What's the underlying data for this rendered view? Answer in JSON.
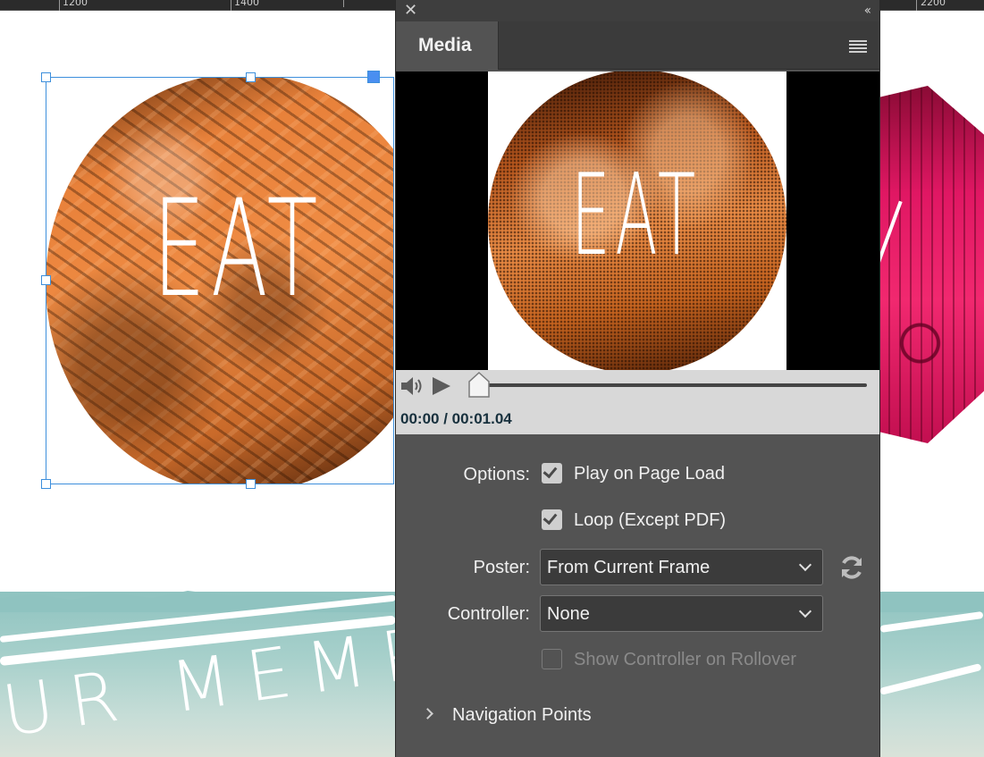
{
  "ruler": {
    "labels": [
      "1200",
      "1400",
      "2200"
    ]
  },
  "document": {
    "left_image_word": "EAT",
    "band_text": "UR MEMP"
  },
  "panel": {
    "tab_label": "Media",
    "preview_word": "EAT",
    "timecode": "00:00 / 00:01.04",
    "options_label": "Options:",
    "play_on_load_label": "Play on Page Load",
    "play_on_load_checked": true,
    "loop_label": "Loop (Except PDF)",
    "loop_checked": true,
    "poster_label": "Poster:",
    "poster_value": "From Current Frame",
    "controller_label": "Controller:",
    "controller_value": "None",
    "show_controller_label": "Show Controller on Rollover",
    "show_controller_checked": false,
    "show_controller_enabled": false,
    "nav_points_label": "Navigation Points",
    "playhead_position": 0
  },
  "icons": {
    "close": "close-icon",
    "collapse": "double-chevron-left-icon",
    "menu": "panel-menu-icon",
    "speaker": "speaker-icon",
    "play": "play-icon",
    "refresh": "refresh-icon",
    "expand": "chevron-right-icon"
  },
  "colors": {
    "panel_bg": "#535353",
    "tab_bar_bg": "#3b3b3b",
    "controller_bg": "#d8d8d8",
    "selection": "#3d8fdc",
    "orange_image": "#e8813a",
    "pink_image": "#e01763"
  }
}
